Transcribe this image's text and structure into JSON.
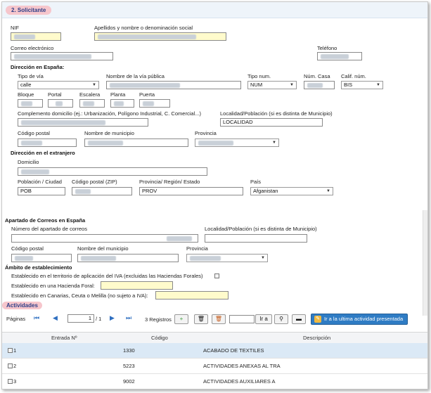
{
  "section2": {
    "title": "2. Solicitante"
  },
  "labels": {
    "nif": "NIF",
    "apellidos": "Apellidos y nombre o denominación social",
    "correo": "Correo electrónico",
    "telefono": "Teléfono",
    "dir_espana": "Dirección en España:",
    "tipo_via": "Tipo de vía",
    "nombre_via": "Nombre de la vía pública",
    "tipo_num": "Tipo num.",
    "num_casa": "Núm. Casa",
    "calif_num": "Calif. núm.",
    "bloque": "Bloque",
    "portal": "Portal",
    "escalera": "Escalera",
    "planta": "Planta",
    "puerta": "Puerta",
    "complemento": "Complemento domicilio (ej.: Urbanización, Polígono Industrial, C. Comercial...)",
    "localidad": "Localidad/Población (si es distinta de Municipio)",
    "cod_postal": "Código postal",
    "nombre_municipio": "Nombre de municipio",
    "provincia": "Provincia",
    "dir_extranjero": "Dirección en el extranjero",
    "domicilio": "Domicilio",
    "poblacion_ciudad": "Población / Ciudad",
    "cod_postal_zip": "Código postal (ZIP)",
    "prov_region": "Provincia/ Región/ Estado",
    "pais": "País",
    "apartado": "Apartado de Correos en España",
    "num_apartado": "Número del apartado de correos",
    "localidad2": "Localidad/Población (si es distinta de Municipio)",
    "cod_postal2": "Código postal",
    "nombre_municipio2": "Nombre del municipio",
    "provincia2": "Provincia",
    "ambito": "Ámbito de establecimiento",
    "est_territorio": "Establecido en el territorio de aplicación del IVA (excluidas las Haciendas Forales)",
    "est_foral": "Establecido en una Hacienda Foral:",
    "est_canarias": "Establecido en Canarias, Ceuta o Melilla (no sujeto a IVA):"
  },
  "values": {
    "tipo_via": "calle",
    "tipo_num": "NUM",
    "calif_num": "BIS",
    "localidad": "LOCALIDAD",
    "poblacion": "POB",
    "prov_region": "PROV",
    "pais": "Afganistan"
  },
  "actividades": {
    "title": "Actividades",
    "paginas_label": "Páginas",
    "page_value": "1",
    "page_total": "/ 1",
    "registros": "3 Registros",
    "ir_a": "Ir a",
    "ir_ultima": "Ir a la ultima actividad presentada",
    "columns": [
      "Entrada Nº",
      "Código",
      "Descripción"
    ],
    "rows": [
      {
        "entrada": "1",
        "codigo": "1330",
        "descripcion": "ACABADO DE TEXTILES"
      },
      {
        "entrada": "2",
        "codigo": "5223",
        "descripcion": "ACTIVIDADES ANEXAS AL TRA"
      },
      {
        "entrada": "3",
        "codigo": "9002",
        "descripcion": "ACTIVIDADES AUXILIARES A"
      }
    ]
  },
  "colors": {
    "accent": "#2f7cc4",
    "pill_bg": "#f6c6cc",
    "field_yellow": "#fffbcc",
    "selected_row": "#dbe9f6"
  }
}
